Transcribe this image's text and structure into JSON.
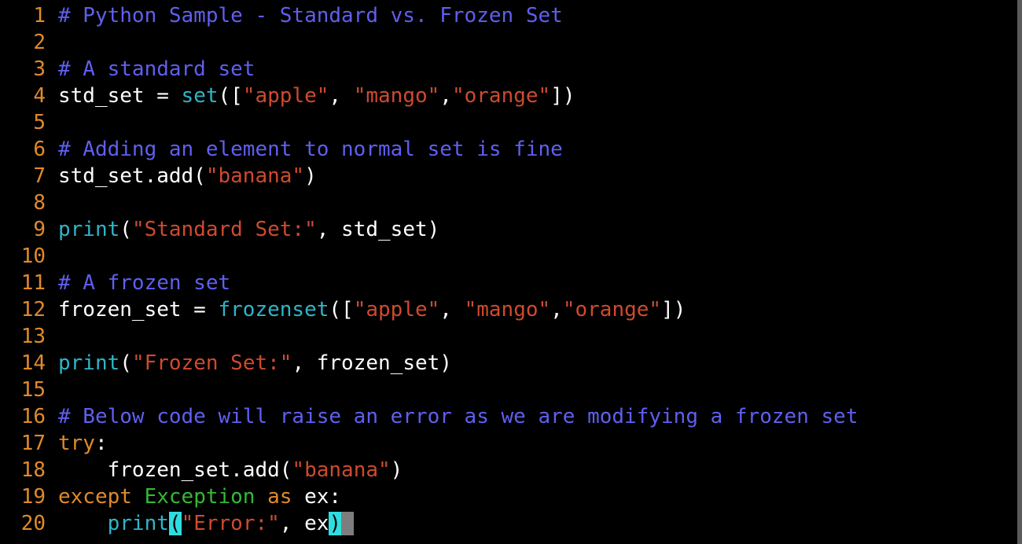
{
  "colors": {
    "background": "#000000",
    "line_number": "#e08a2b",
    "comment": "#5f5ff0",
    "plain": "#ffffff",
    "builtin": "#2fb5c8",
    "string": "#cf4a2e",
    "keyword": "#e08a2b",
    "class": "#35b935",
    "bracket_match": "#2fdde0",
    "cursor": "#7d7d7d"
  },
  "editor": {
    "lines": [
      {
        "number": "1",
        "tokens": [
          {
            "t": "# Python Sample - Standard vs. Frozen Set",
            "c": "comment"
          }
        ]
      },
      {
        "number": "2",
        "tokens": []
      },
      {
        "number": "3",
        "tokens": [
          {
            "t": "# A standard set",
            "c": "comment"
          }
        ]
      },
      {
        "number": "4",
        "tokens": [
          {
            "t": "std_set = ",
            "c": "plain"
          },
          {
            "t": "set",
            "c": "builtin"
          },
          {
            "t": "([",
            "c": "plain"
          },
          {
            "t": "\"apple\"",
            "c": "string"
          },
          {
            "t": ", ",
            "c": "plain"
          },
          {
            "t": "\"mango\"",
            "c": "string"
          },
          {
            "t": ",",
            "c": "plain"
          },
          {
            "t": "\"orange\"",
            "c": "string"
          },
          {
            "t": "])",
            "c": "plain"
          }
        ]
      },
      {
        "number": "5",
        "tokens": []
      },
      {
        "number": "6",
        "tokens": [
          {
            "t": "# Adding an element to normal set is fine",
            "c": "comment"
          }
        ]
      },
      {
        "number": "7",
        "tokens": [
          {
            "t": "std_set.add(",
            "c": "plain"
          },
          {
            "t": "\"banana\"",
            "c": "string"
          },
          {
            "t": ")",
            "c": "plain"
          }
        ]
      },
      {
        "number": "8",
        "tokens": []
      },
      {
        "number": "9",
        "tokens": [
          {
            "t": "print",
            "c": "builtin"
          },
          {
            "t": "(",
            "c": "plain"
          },
          {
            "t": "\"Standard Set:\"",
            "c": "string"
          },
          {
            "t": ", std_set)",
            "c": "plain"
          }
        ]
      },
      {
        "number": "10",
        "tokens": []
      },
      {
        "number": "11",
        "tokens": [
          {
            "t": "# A frozen set",
            "c": "comment"
          }
        ]
      },
      {
        "number": "12",
        "tokens": [
          {
            "t": "frozen_set = ",
            "c": "plain"
          },
          {
            "t": "frozenset",
            "c": "builtin"
          },
          {
            "t": "([",
            "c": "plain"
          },
          {
            "t": "\"apple\"",
            "c": "string"
          },
          {
            "t": ", ",
            "c": "plain"
          },
          {
            "t": "\"mango\"",
            "c": "string"
          },
          {
            "t": ",",
            "c": "plain"
          },
          {
            "t": "\"orange\"",
            "c": "string"
          },
          {
            "t": "])",
            "c": "plain"
          }
        ]
      },
      {
        "number": "13",
        "tokens": []
      },
      {
        "number": "14",
        "tokens": [
          {
            "t": "print",
            "c": "builtin"
          },
          {
            "t": "(",
            "c": "plain"
          },
          {
            "t": "\"Frozen Set:\"",
            "c": "string"
          },
          {
            "t": ", frozen_set)",
            "c": "plain"
          }
        ]
      },
      {
        "number": "15",
        "tokens": []
      },
      {
        "number": "16",
        "tokens": [
          {
            "t": "# Below code will raise an error as we are modifying a frozen set",
            "c": "comment"
          }
        ]
      },
      {
        "number": "17",
        "tokens": [
          {
            "t": "try",
            "c": "keyword"
          },
          {
            "t": ":",
            "c": "plain"
          }
        ]
      },
      {
        "number": "18",
        "tokens": [
          {
            "t": "    frozen_set.add(",
            "c": "plain"
          },
          {
            "t": "\"banana\"",
            "c": "string"
          },
          {
            "t": ")",
            "c": "plain"
          }
        ]
      },
      {
        "number": "19",
        "tokens": [
          {
            "t": "except",
            "c": "keyword"
          },
          {
            "t": " ",
            "c": "plain"
          },
          {
            "t": "Exception",
            "c": "class"
          },
          {
            "t": " ",
            "c": "plain"
          },
          {
            "t": "as",
            "c": "keyword"
          },
          {
            "t": " ex:",
            "c": "plain"
          }
        ]
      },
      {
        "number": "20",
        "tokens": [
          {
            "t": "    ",
            "c": "plain"
          },
          {
            "t": "print",
            "c": "builtin"
          },
          {
            "t": "(",
            "c": "match"
          },
          {
            "t": "\"Error:\"",
            "c": "string"
          },
          {
            "t": ", ex",
            "c": "plain"
          },
          {
            "t": ")",
            "c": "match"
          },
          {
            "t": "",
            "c": "cursor"
          }
        ]
      }
    ]
  }
}
